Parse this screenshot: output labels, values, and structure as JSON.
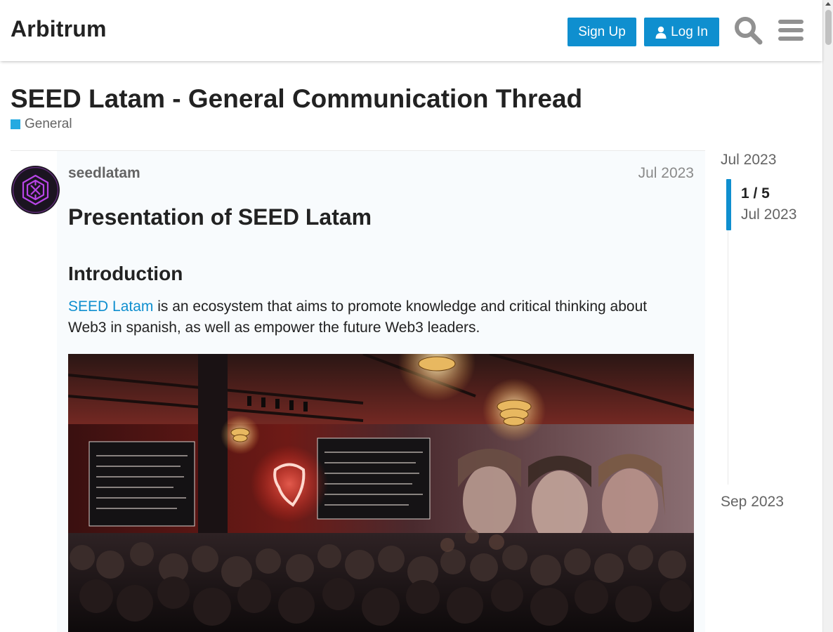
{
  "header": {
    "site_title": "Arbitrum",
    "signup_label": "Sign Up",
    "login_label": "Log In",
    "accent": "#0f8fcf"
  },
  "topic": {
    "title": "SEED Latam - General Communication Thread",
    "category": {
      "name": "General",
      "color": "#25aae1"
    }
  },
  "post": {
    "username": "seedlatam",
    "date": "Jul 2023",
    "heading": "Presentation of SEED Latam",
    "subheading": "Introduction",
    "link_text": "SEED Latam",
    "body_text": " is an ecosystem that aims to promote knowledge and critical thinking about Web3 in spanish, as well as empower the future Web3 leaders.",
    "image_icon": "event-photo"
  },
  "timeline": {
    "start_date": "Jul 2023",
    "position": "1 / 5",
    "position_date": "Jul 2023",
    "end_date": "Sep 2023"
  },
  "icons": {
    "search": "search-icon",
    "menu": "hamburger-menu-icon",
    "user": "user-icon"
  }
}
